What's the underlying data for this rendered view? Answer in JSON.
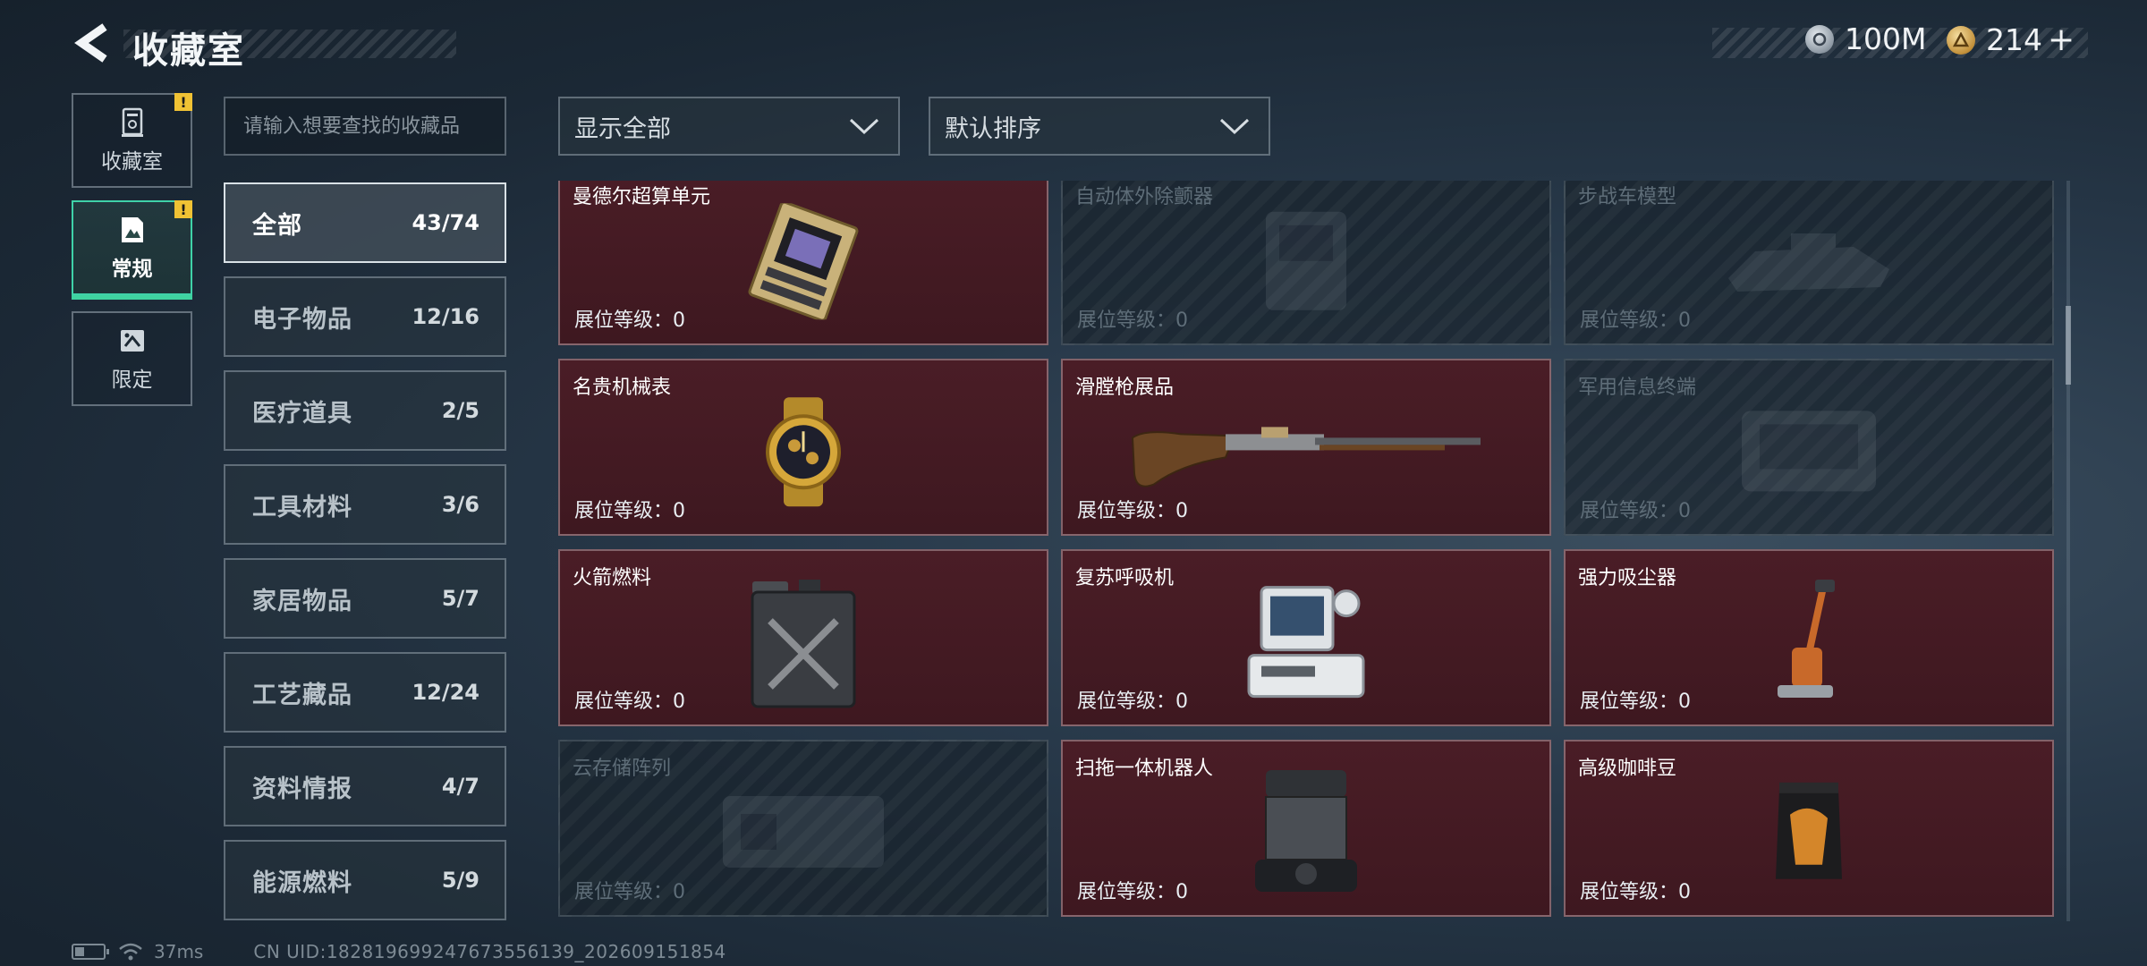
{
  "header": {
    "title": "收藏室",
    "currencies": [
      {
        "name": "silver-coin",
        "value": "100M"
      },
      {
        "name": "gold-coin",
        "value": "214"
      }
    ],
    "add_symbol": "+"
  },
  "side_tabs": [
    {
      "label": "收藏室",
      "alert": "!",
      "active": false,
      "icon": "trophy-case-icon"
    },
    {
      "label": "常规",
      "alert": "!",
      "active": true,
      "icon": "picture-icon"
    },
    {
      "label": "限定",
      "alert": "",
      "active": false,
      "icon": "limited-icon"
    }
  ],
  "search": {
    "placeholder": "请输入想要查找的收藏品"
  },
  "categories": [
    {
      "name": "全部",
      "count": "43/74",
      "active": true
    },
    {
      "name": "电子物品",
      "count": "12/16",
      "active": false
    },
    {
      "name": "医疗道具",
      "count": "2/5",
      "active": false
    },
    {
      "name": "工具材料",
      "count": "3/6",
      "active": false
    },
    {
      "name": "家居物品",
      "count": "5/7",
      "active": false
    },
    {
      "name": "工艺藏品",
      "count": "12/24",
      "active": false
    },
    {
      "name": "资料情报",
      "count": "4/7",
      "active": false
    },
    {
      "name": "能源燃料",
      "count": "5/9",
      "active": false
    }
  ],
  "filters": {
    "show": "显示全部",
    "sort": "默认排序"
  },
  "level_label": "展位等级：",
  "items": [
    {
      "name": "曼德尔超算单元",
      "level": "0",
      "owned": true,
      "icon": "supercomputer-chip-icon"
    },
    {
      "name": "自动体外除颤器",
      "level": "0",
      "owned": false,
      "icon": "defibrillator-icon"
    },
    {
      "name": "步战车模型",
      "level": "0",
      "owned": false,
      "icon": "ifv-model-icon"
    },
    {
      "name": "名贵机械表",
      "level": "0",
      "owned": true,
      "icon": "luxury-watch-icon"
    },
    {
      "name": "滑膛枪展品",
      "level": "0",
      "owned": true,
      "icon": "musket-icon"
    },
    {
      "name": "军用信息终端",
      "level": "0",
      "owned": false,
      "icon": "military-terminal-icon"
    },
    {
      "name": "火箭燃料",
      "level": "0",
      "owned": true,
      "icon": "fuel-jerrycan-icon"
    },
    {
      "name": "复苏呼吸机",
      "level": "0",
      "owned": true,
      "icon": "ventilator-icon"
    },
    {
      "name": "强力吸尘器",
      "level": "0",
      "owned": true,
      "icon": "vacuum-cleaner-icon"
    },
    {
      "name": "云存储阵列",
      "level": "0",
      "owned": false,
      "icon": "storage-array-icon"
    },
    {
      "name": "扫拖一体机器人",
      "level": "0",
      "owned": true,
      "icon": "robot-mop-icon"
    },
    {
      "name": "高级咖啡豆",
      "level": "0",
      "owned": true,
      "icon": "coffee-bag-icon"
    }
  ],
  "status_bar": {
    "ping": "37ms",
    "uid": "CN UID:182819699247673556139_202609151854"
  },
  "colors": {
    "owned_card": "#4a1d26",
    "active_tab_accent": "#3fd39f",
    "alert": "#f0c234"
  }
}
